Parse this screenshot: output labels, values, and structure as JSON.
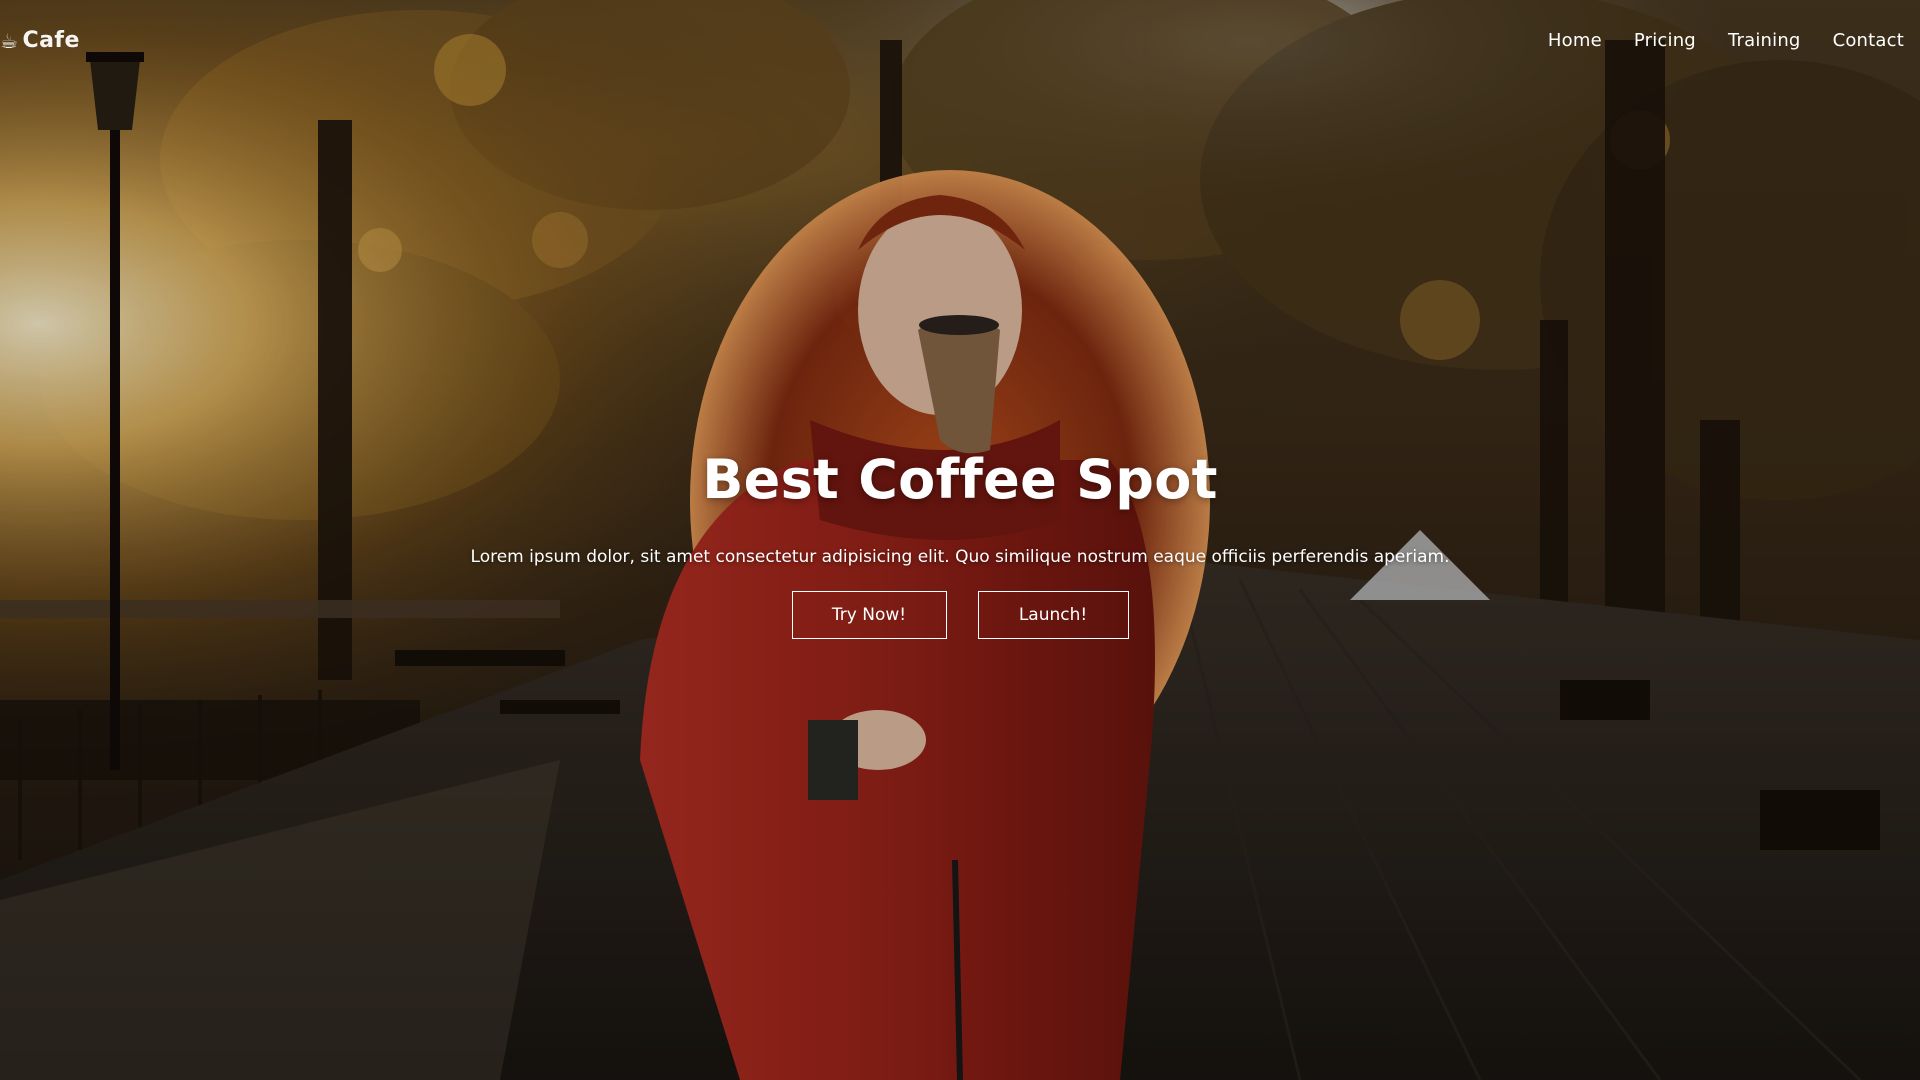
{
  "navbar": {
    "logo_text": "Cafe",
    "logo_icon": "coffee-cup-icon",
    "links": [
      "Home",
      "Pricing",
      "Training",
      "Contact"
    ]
  },
  "hero": {
    "title": "Best Coffee Spot",
    "subtitle": "Lorem ipsum dolor, sit amet consectetur adipisicing elit. Quo similique nostrum eaque officiis perferendis aperiam.",
    "buttons": {
      "try_label": "Try Now!",
      "launch_label": "Launch!"
    },
    "background_image": "woman-in-red-coat-drinking-coffee-in-autumn-park"
  },
  "colors": {
    "text": "#ffffff",
    "accent_coat": "#9e2418",
    "foliage": "#9a6a22"
  }
}
